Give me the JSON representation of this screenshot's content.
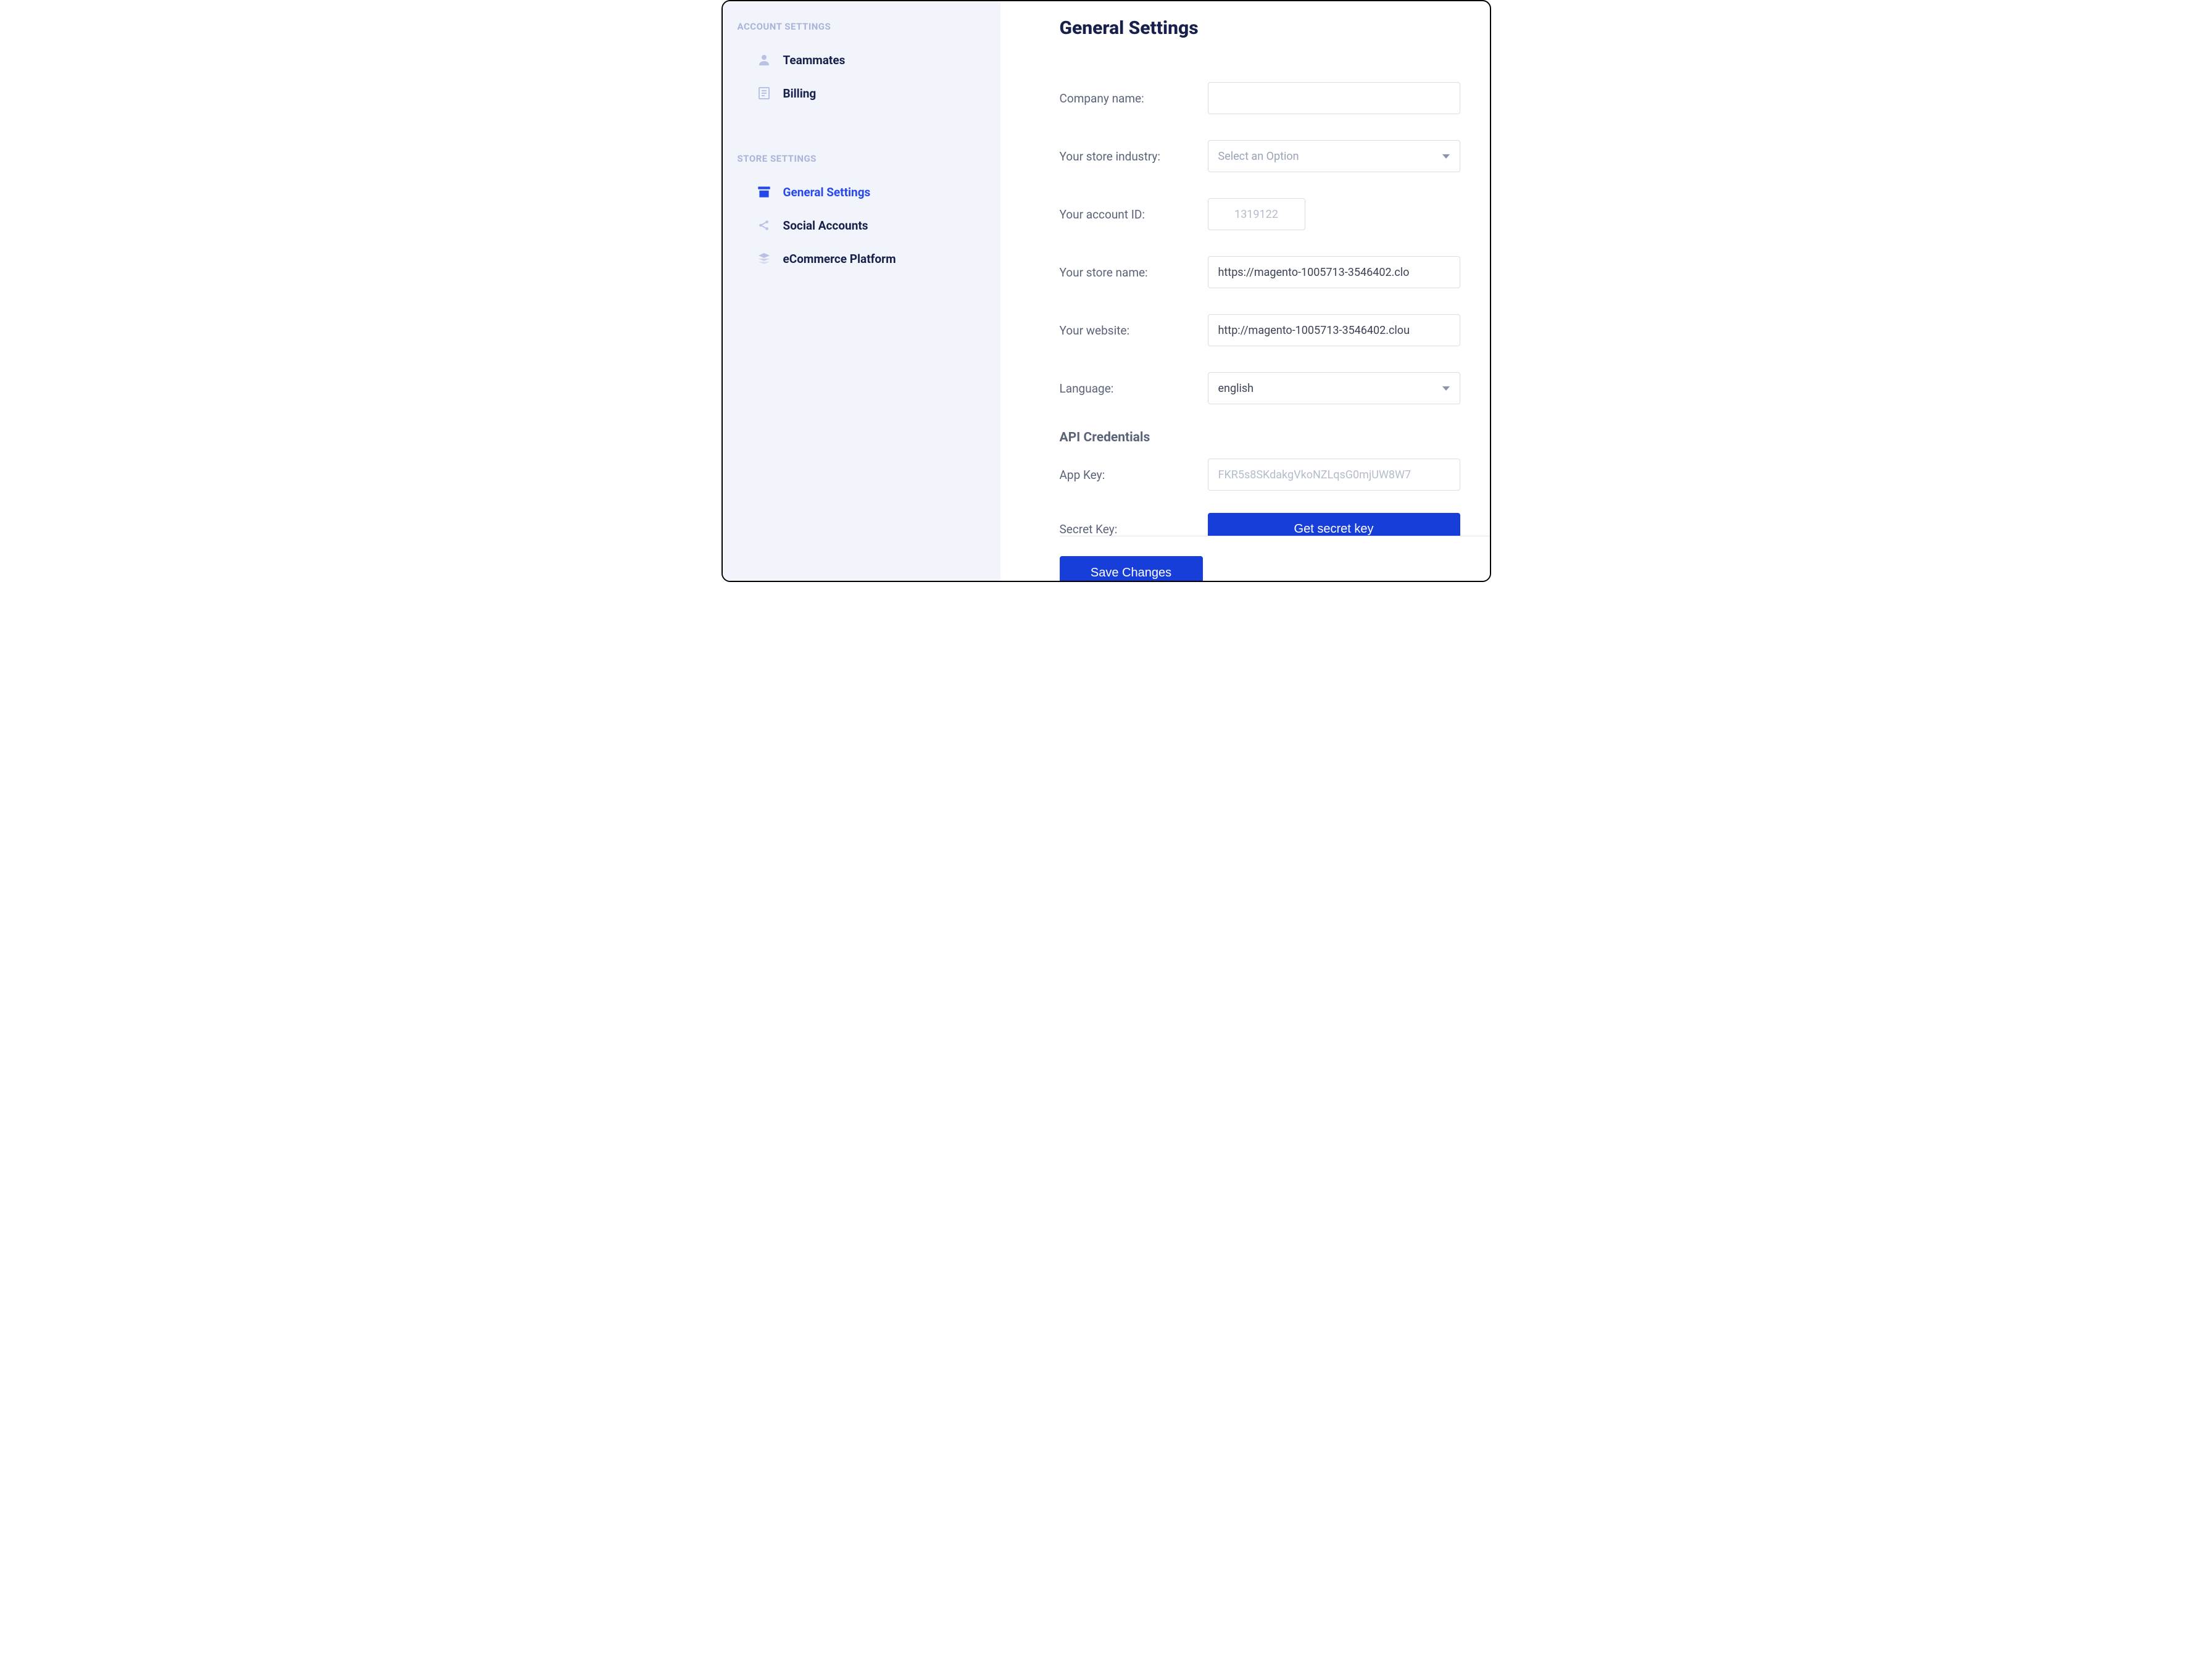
{
  "sidebar": {
    "sections": {
      "account": {
        "title": "ACCOUNT SETTINGS",
        "items": [
          {
            "label": "Teammates"
          },
          {
            "label": "Billing"
          }
        ]
      },
      "store": {
        "title": "STORE SETTINGS",
        "items": [
          {
            "label": "General Settings"
          },
          {
            "label": "Social Accounts"
          },
          {
            "label": "eCommerce Platform"
          }
        ]
      }
    }
  },
  "page": {
    "title": "General Settings",
    "labels": {
      "company_name": "Company name:",
      "store_industry": "Your store industry:",
      "account_id": "Your account ID:",
      "store_name": "Your store name:",
      "website": "Your website:",
      "language": "Language:",
      "api_section": "API Credentials",
      "app_key": "App Key:",
      "secret_key": "Secret Key:"
    },
    "values": {
      "company_name": "",
      "industry_placeholder": "Select an Option",
      "account_id": "1319122",
      "store_name": "https://magento-1005713-3546402.clo",
      "website": "http://magento-1005713-3546402.clou",
      "language": "english",
      "app_key": "FKR5s8SKdakgVkoNZLqsG0mjUW8W7"
    },
    "buttons": {
      "get_secret": "Get secret key",
      "save": "Save Changes"
    }
  },
  "colors": {
    "accent": "#173ed9",
    "sidebar_bg": "#f2f4fc",
    "text_dark": "#17204a",
    "text_muted": "#5a6378"
  }
}
